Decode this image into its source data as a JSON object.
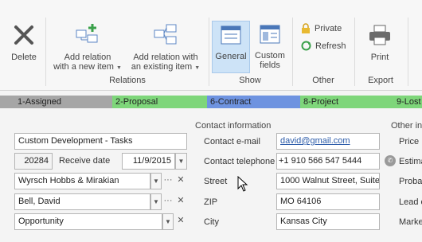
{
  "ribbon": {
    "delete_label": "Delete",
    "add_new_label_1": "Add relation",
    "add_new_label_2": "with a new item",
    "add_existing_label_1": "Add relation with",
    "add_existing_label_2": "an existing item",
    "relations_group": "Relations",
    "general_label": "General",
    "custom_fields_label_1": "Custom",
    "custom_fields_label_2": "fields",
    "show_group": "Show",
    "private_label": "Private",
    "refresh_label": "Refresh",
    "other_group": "Other",
    "print_label": "Print",
    "export_group": "Export"
  },
  "stages": [
    {
      "label": "1-Assigned",
      "color": "#a6a6a6"
    },
    {
      "label": "2-Proposal",
      "color": "#7ed67a"
    },
    {
      "label": "6-Contract",
      "color": "#6e93e0"
    },
    {
      "label": "8-Project",
      "color": "#7ed67a"
    },
    {
      "label": "9-Lost",
      "color": "#7ed67a"
    }
  ],
  "form": {
    "subject": "Custom Development - Tasks",
    "number": "20284",
    "receive_date_label": "Receive date",
    "receive_date": "11/9/2015",
    "company": "Wyrsch Hobbs & Mirakian",
    "person": "Bell, David",
    "type": "Opportunity"
  },
  "contact": {
    "header": "Contact information",
    "email_label": "Contact e-mail",
    "email": "david@gmail.com",
    "phone_label": "Contact telephone",
    "phone": "+1 910 566 547 5444",
    "street_label": "Street",
    "street": "1000 Walnut Street, Suite",
    "zip_label": "ZIP",
    "zip": "MO 64106",
    "city_label": "City",
    "city": "Kansas City"
  },
  "other": {
    "header": "Other info",
    "price_label": "Price",
    "estimate_label": "Estima",
    "probability_label": "Probab",
    "lead_label": "Lead c",
    "market_label": "Marke"
  }
}
